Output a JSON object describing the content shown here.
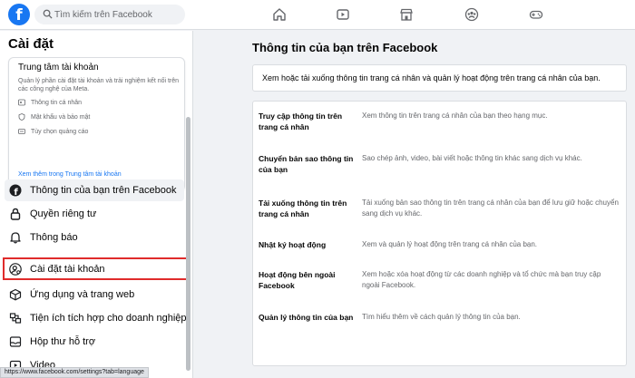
{
  "topbar": {
    "logo": "f",
    "search_placeholder": "Tìm kiếm trên Facebook",
    "nav_icons": [
      "home-icon",
      "video-icon",
      "marketplace-icon",
      "groups-icon",
      "gaming-icon"
    ]
  },
  "sidebar": {
    "title": "Cài đặt",
    "account_center": {
      "title": "Trung tâm tài khoản",
      "description": "Quản lý phần cài đặt tài khoản và trải nghiệm kết nối trên các công nghệ của Meta.",
      "items": [
        {
          "label": "Thông tin cá nhân",
          "icon": "id-card-icon"
        },
        {
          "label": "Mật khẩu và bảo mật",
          "icon": "shield-icon"
        },
        {
          "label": "Tùy chọn quảng cáo",
          "icon": "ad-icon"
        }
      ],
      "link": "Xem thêm trong Trung tâm tài khoản"
    },
    "menu": [
      {
        "label": "Thông tin của bạn trên Facebook",
        "icon": "facebook-icon"
      },
      {
        "label": "Quyền riêng tư",
        "icon": "lock-icon"
      },
      {
        "label": "Thông báo",
        "icon": "bell-icon"
      },
      {
        "label": "Cài đặt tài khoản",
        "icon": "user-settings-icon"
      },
      {
        "label": "Ứng dụng và trang web",
        "icon": "cube-icon"
      },
      {
        "label": "Tiện ích tích hợp cho doanh nghiệp",
        "icon": "integration-icon"
      },
      {
        "label": "Hộp thư hỗ trợ",
        "icon": "inbox-icon"
      },
      {
        "label": "Video",
        "icon": "video-icon"
      }
    ]
  },
  "statusbar": "https://www.facebook.com/settings?tab=language",
  "main": {
    "title": "Thông tin của bạn trên Facebook",
    "description": "Xem hoặc tải xuống thông tin trang cá nhân và quản lý hoạt động trên trang cá nhân của bạn.",
    "rows": [
      {
        "label": "Truy cập thông tin trên trang cá nhân",
        "desc": "Xem thông tin trên trang cá nhân của bạn theo hạng mục."
      },
      {
        "label": "Chuyển bản sao thông tin của bạn",
        "desc": "Sao chép ảnh, video, bài viết hoặc thông tin khác sang dịch vụ khác."
      },
      {
        "label": "Tải xuống thông tin trên trang cá nhân",
        "desc": "Tải xuống bản sao thông tin trên trang cá nhân của bạn để lưu giữ hoặc chuyển sang dịch vụ khác."
      },
      {
        "label": "Nhật ký hoạt động",
        "desc": "Xem và quản lý hoạt động trên trang cá nhân của bạn."
      },
      {
        "label": "Hoạt động bên ngoài Facebook",
        "desc": "Xem hoặc xóa hoạt động từ các doanh nghiệp và tổ chức mà bạn truy cập ngoài Facebook."
      },
      {
        "label": "Quản lý thông tin của bạn",
        "desc": "Tìm hiểu thêm về cách quản lý thông tin của bạn."
      }
    ]
  },
  "colors": {
    "brand": "#1877f2",
    "highlight_box": "#e02b2b"
  }
}
